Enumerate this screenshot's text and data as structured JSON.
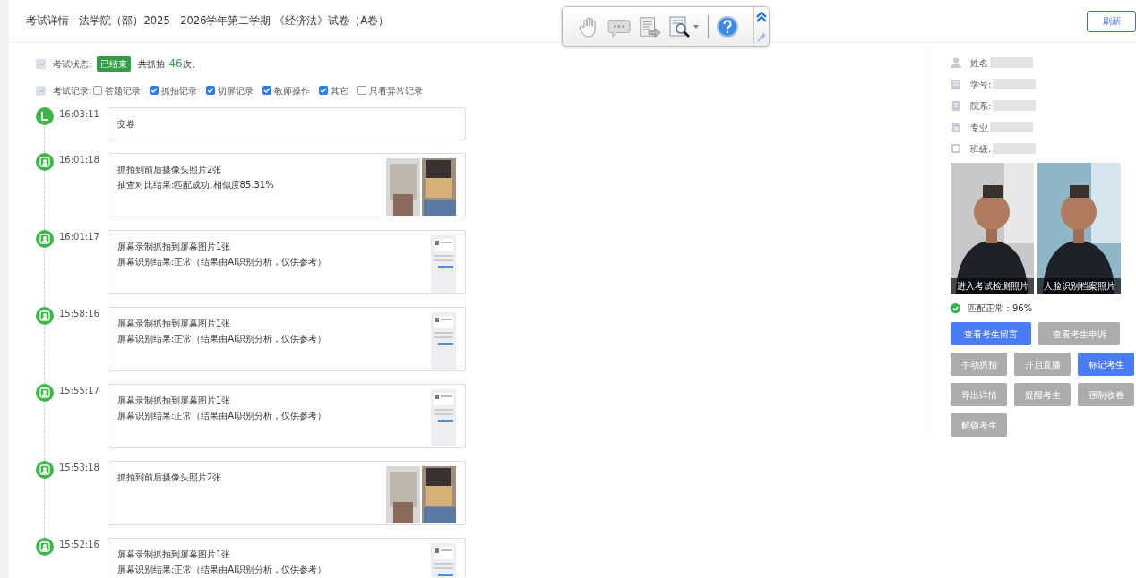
{
  "header": {
    "title": "考试详情 - 法学院（部）2025—2026学年第二学期 《经济法》试卷（A卷）",
    "refresh_button": "刷新"
  },
  "status": {
    "label": "考试状态:",
    "badge": "已结束",
    "capture_prefix": "共抓拍",
    "capture_count": "46",
    "capture_suffix": "次。"
  },
  "filters": {
    "label": "考试记录:",
    "options": [
      {
        "label": "答题记录",
        "checked": false
      },
      {
        "label": "抓拍记录",
        "checked": true
      },
      {
        "label": "切屏记录",
        "checked": true
      },
      {
        "label": "教师操作",
        "checked": true
      },
      {
        "label": "其它",
        "checked": true
      },
      {
        "label": "只看异常记录",
        "checked": false
      }
    ]
  },
  "timeline": [
    {
      "kind": "submit",
      "time": "16:03:11",
      "lines": [
        "交卷"
      ]
    },
    {
      "kind": "camera",
      "time": "16:01:18",
      "lines": [
        "抓拍到前后摄像头照片2张",
        "抽查对比结果:匹配成功,相似度85.31%"
      ]
    },
    {
      "kind": "screen",
      "time": "16:01:17",
      "lines": [
        "屏幕录制抓拍到屏幕图片1张",
        "屏幕识别结果:正常（结果由AI识别分析，仅供参考）"
      ]
    },
    {
      "kind": "screen",
      "time": "15:58:16",
      "lines": [
        "屏幕录制抓拍到屏幕图片1张",
        "屏幕识别结果:正常（结果由AI识别分析，仅供参考）"
      ]
    },
    {
      "kind": "screen",
      "time": "15:55:17",
      "lines": [
        "屏幕录制抓拍到屏幕图片1张",
        "屏幕识别结果:正常（结果由AI识别分析，仅供参考）"
      ]
    },
    {
      "kind": "camera",
      "time": "15:53:18",
      "lines": [
        "抓拍到前后摄像头照片2张"
      ]
    },
    {
      "kind": "screen",
      "time": "15:52:16",
      "lines": [
        "屏幕录制抓拍到屏幕图片1张",
        "屏幕识别结果:正常（结果由AI识别分析，仅供参考）"
      ]
    }
  ],
  "student": {
    "fields": [
      {
        "kind": "person",
        "label": "姓名"
      },
      {
        "kind": "card",
        "label": "学号:"
      },
      {
        "kind": "building",
        "label": "院系:"
      },
      {
        "kind": "doc",
        "label": "专业"
      },
      {
        "kind": "class",
        "label": "班级."
      }
    ],
    "photos": [
      {
        "caption": "进入考试检测照片"
      },
      {
        "caption": "人脸识别档案照片"
      }
    ],
    "match": "匹配正常：96%",
    "button_rows": [
      [
        {
          "label": "查看考生留言",
          "disabled": false
        },
        {
          "label": "查看考生申诉",
          "disabled": true
        }
      ],
      [
        {
          "label": "手动抓拍",
          "disabled": true
        },
        {
          "label": "开启直播",
          "disabled": true
        },
        {
          "label": "标记考生",
          "disabled": false
        }
      ],
      [
        {
          "label": "导出详情",
          "disabled": true
        },
        {
          "label": "提醒考生",
          "disabled": true
        },
        {
          "label": "强制收卷",
          "disabled": true
        }
      ],
      [
        {
          "label": "解锁考生",
          "disabled": true
        }
      ]
    ]
  }
}
